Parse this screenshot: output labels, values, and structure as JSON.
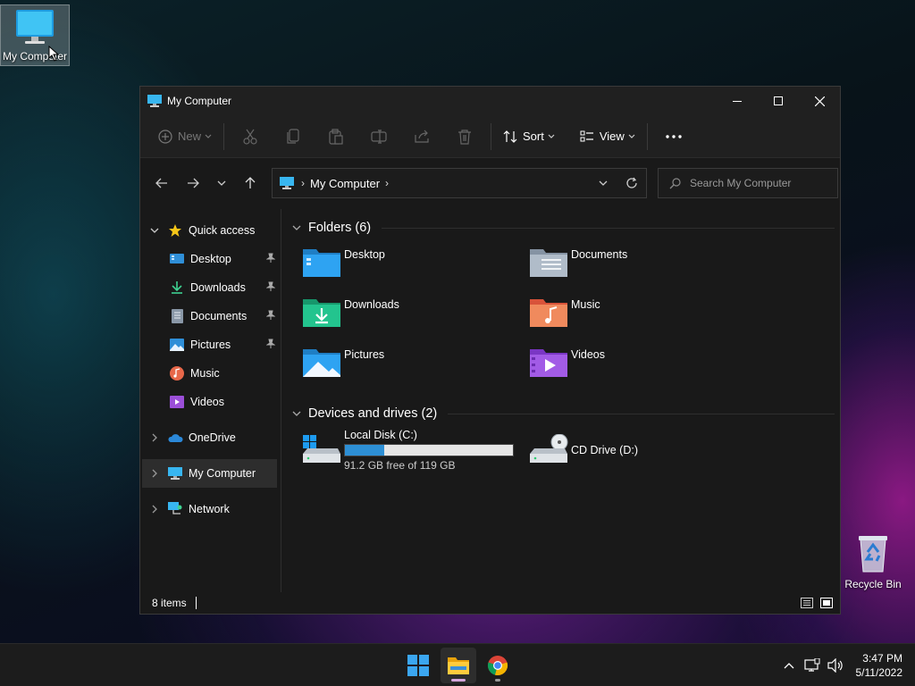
{
  "desktop": {
    "my_computer_label": "My Computer",
    "recycle_bin_label": "Recycle Bin"
  },
  "window": {
    "title": "My Computer",
    "commands": {
      "new": "New",
      "sort": "Sort",
      "view": "View"
    },
    "address": {
      "crumb": "My Computer"
    },
    "search": {
      "placeholder": "Search My Computer"
    },
    "sidebar": {
      "quick_access": "Quick access",
      "items": [
        {
          "label": "Desktop",
          "pinned": true
        },
        {
          "label": "Downloads",
          "pinned": true
        },
        {
          "label": "Documents",
          "pinned": true
        },
        {
          "label": "Pictures",
          "pinned": true
        },
        {
          "label": "Music",
          "pinned": false
        },
        {
          "label": "Videos",
          "pinned": false
        }
      ],
      "onedrive": "OneDrive",
      "my_computer": "My Computer",
      "network": "Network"
    },
    "folders": {
      "header": "Folders (6)",
      "items": [
        {
          "name": "Desktop",
          "icon": "desktop-folder-icon"
        },
        {
          "name": "Documents",
          "icon": "documents-folder-icon"
        },
        {
          "name": "Downloads",
          "icon": "downloads-folder-icon"
        },
        {
          "name": "Music",
          "icon": "music-folder-icon"
        },
        {
          "name": "Pictures",
          "icon": "pictures-folder-icon"
        },
        {
          "name": "Videos",
          "icon": "videos-folder-icon"
        }
      ]
    },
    "drives": {
      "header": "Devices and drives (2)",
      "local": {
        "name": "Local Disk (C:)",
        "free": "91.2 GB free of 119 GB",
        "used_fraction": 0.234
      },
      "cd": {
        "name": "CD Drive (D:)"
      }
    },
    "status": {
      "items": "8 items"
    }
  },
  "taskbar": {
    "time": "3:47 PM",
    "date": "5/11/2022"
  },
  "colors": {
    "accent": "#2d8fd5",
    "window_bg": "#191919",
    "titlebar_bg": "#202020"
  }
}
